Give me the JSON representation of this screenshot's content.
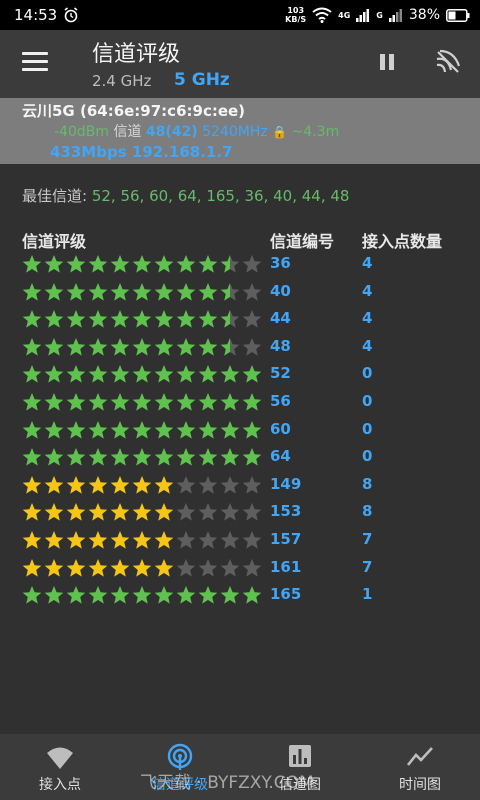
{
  "status_bar": {
    "time": "14:53",
    "net_speed": "103",
    "net_unit": "KB/S",
    "signal_4g": "4G",
    "signal_g": "G",
    "battery": "38%"
  },
  "app_bar": {
    "title": "信道评级",
    "band_24": "2.4 GHz",
    "band_5": "5 GHz"
  },
  "connected": {
    "ssid": "云川5G (64:6e:97:c6:9c:ee)",
    "signal": "-40dBm",
    "channel_label": "信道",
    "channel_value": "48(42)",
    "frequency": "5240MHz",
    "lock_symbol": "🔒",
    "extra": "~4.3m",
    "speed": "433Mbps",
    "ip": "192.168.1.7"
  },
  "best_channels": {
    "label": "最佳信道:",
    "value": "52, 56, 60, 64, 165, 36, 40, 44, 48"
  },
  "headers": {
    "rating": "信道评级",
    "channel": "信道编号",
    "ap_count": "接入点数量"
  },
  "colors": {
    "green_star": "#5fc24f",
    "yellow_star": "#f5c518",
    "gray_star": "#5e5e5e",
    "blue": "#42a5f5"
  },
  "rows": [
    {
      "channel": "36",
      "ap_count": "4",
      "stars": 9.5,
      "color": "green"
    },
    {
      "channel": "40",
      "ap_count": "4",
      "stars": 9.5,
      "color": "green"
    },
    {
      "channel": "44",
      "ap_count": "4",
      "stars": 9.5,
      "color": "green"
    },
    {
      "channel": "48",
      "ap_count": "4",
      "stars": 9.5,
      "color": "green"
    },
    {
      "channel": "52",
      "ap_count": "0",
      "stars": 11.5,
      "color": "green"
    },
    {
      "channel": "56",
      "ap_count": "0",
      "stars": 11.5,
      "color": "green"
    },
    {
      "channel": "60",
      "ap_count": "0",
      "stars": 11.5,
      "color": "green"
    },
    {
      "channel": "64",
      "ap_count": "0",
      "stars": 11.5,
      "color": "green"
    },
    {
      "channel": "149",
      "ap_count": "8",
      "stars": 7,
      "color": "yellow"
    },
    {
      "channel": "153",
      "ap_count": "8",
      "stars": 7,
      "color": "yellow"
    },
    {
      "channel": "157",
      "ap_count": "7",
      "stars": 7,
      "color": "yellow"
    },
    {
      "channel": "161",
      "ap_count": "7",
      "stars": 7,
      "color": "yellow"
    },
    {
      "channel": "165",
      "ap_count": "1",
      "stars": 11.5,
      "color": "green"
    }
  ],
  "total_stars": 11,
  "bottom_nav": [
    {
      "label": "接入点",
      "icon": "wifi-icon",
      "active": false
    },
    {
      "label": "信道评级",
      "icon": "radar-icon",
      "active": true
    },
    {
      "label": "信道图",
      "icon": "bar-chart-icon",
      "active": false
    },
    {
      "label": "时间图",
      "icon": "line-chart-icon",
      "active": false
    }
  ],
  "watermark": "飞天载 · BYFZXY.COM"
}
